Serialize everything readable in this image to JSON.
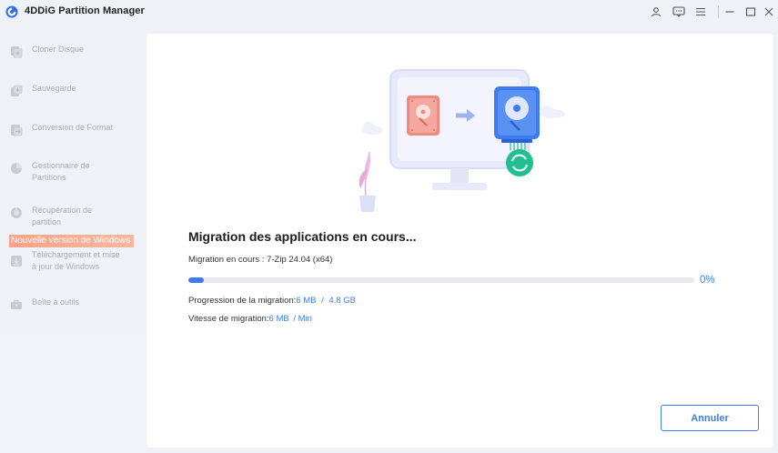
{
  "window": {
    "title": "4DDiG Partition Manager",
    "icons": [
      "user-icon",
      "feedback-icon",
      "menu-icon",
      "minimize-icon",
      "maximize-icon",
      "close-icon"
    ]
  },
  "sidebar": {
    "items": [
      {
        "label": "Cloner Disque",
        "icon": "clone-disk-icon"
      },
      {
        "label": "Sauvegarde",
        "icon": "backup-icon"
      },
      {
        "label": "Conversion de Format",
        "icon": "convert-icon"
      },
      {
        "label": "Gestionnaire de\nPartitions",
        "icon": "partition-manager-icon"
      },
      {
        "label": "Récupération de\npartition",
        "icon": "partition-recovery-icon"
      },
      {
        "label": "Téléchargement et mise\nà jour de Windows",
        "icon": "windows-download-icon"
      },
      {
        "label": "Boîte à outils",
        "icon": "toolbox-icon"
      }
    ],
    "new_badge": "Nouvelle version de Windows"
  },
  "migration": {
    "title": "Migration des applications en cours...",
    "current_label": "Migration en cours :",
    "current_app": "7-Zip 24.04 (x64)",
    "progress_fraction": 0.03,
    "progress_text": "0%",
    "progress_label": "Progression de la migration:",
    "progress_done": "6 MB",
    "progress_sep": "/",
    "progress_total": "4.8 GB",
    "speed_label": "Vitesse de migration:",
    "speed_value": "6 MB",
    "speed_unit": "/ Min"
  },
  "actions": {
    "cancel_label": "Annuler"
  },
  "colors": {
    "accent": "#3c7cf0",
    "badge": "#f6a38a",
    "source_disk": "#f08a80",
    "target_disk": "#3c7cf0",
    "sync": "#1fbf8f"
  }
}
